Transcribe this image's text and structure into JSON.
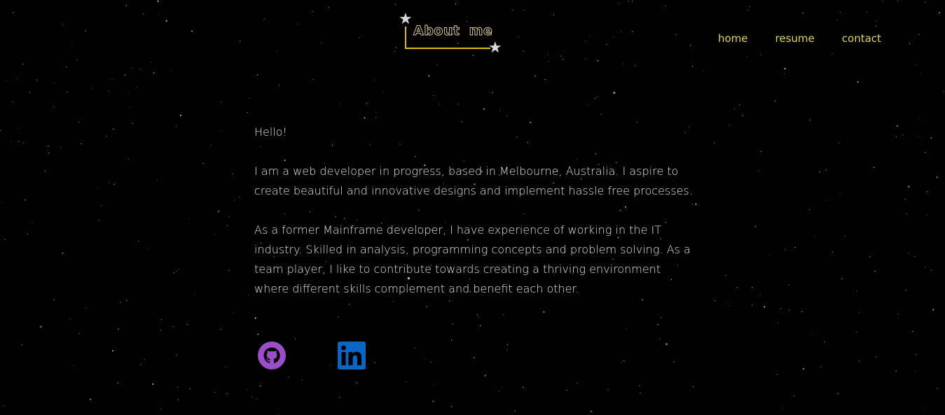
{
  "header": {
    "logo_text": "About me",
    "nav": [
      {
        "label": "home"
      },
      {
        "label": "resume"
      },
      {
        "label": "contact"
      }
    ]
  },
  "main": {
    "greeting": "Hello!",
    "paragraphs": [
      "I am a web developer in progress, based in Melbourne, Australia. I aspire to create beautiful and innovative designs and implement hassle free processes.",
      "As a former Mainframe developer, I have experience of working in the IT industry. Skilled in analysis, programming concepts and problem solving. As a team player, I like to contribute towards creating a thriving environment where different skills complement and benefit each other."
    ]
  },
  "social": [
    {
      "icon": "github-icon",
      "color": "#9b4dca"
    },
    {
      "icon": "linkedin-icon",
      "color": "#0a66c2"
    }
  ],
  "colors": {
    "background": "#020202",
    "nav_link": "#d9d36a",
    "logo_accent": "#e0b818",
    "body_text": "#e2e2e2"
  }
}
